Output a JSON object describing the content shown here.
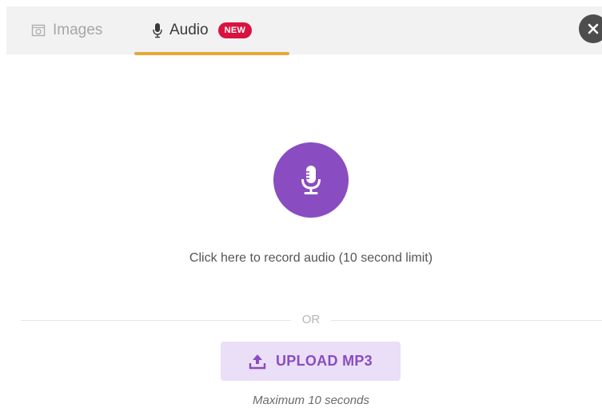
{
  "tabs": [
    {
      "label": "Images",
      "icon": "image-icon",
      "active": false
    },
    {
      "label": "Audio",
      "icon": "microphone-icon",
      "active": true,
      "badge": "NEW"
    }
  ],
  "record": {
    "icon": "microphone-icon",
    "label": "Click here to record audio (10 second limit)"
  },
  "separator": {
    "label": "OR"
  },
  "upload": {
    "icon": "upload-icon",
    "label": "UPLOAD MP3",
    "note": "Maximum 10 seconds"
  },
  "close": {
    "icon": "close-icon"
  },
  "colors": {
    "accent_purple": "#8a4cc1",
    "upload_bg": "#eadff6",
    "tab_underline": "#e6a93a",
    "badge_red": "#d9123f",
    "close_bg": "#4d4d4d"
  }
}
